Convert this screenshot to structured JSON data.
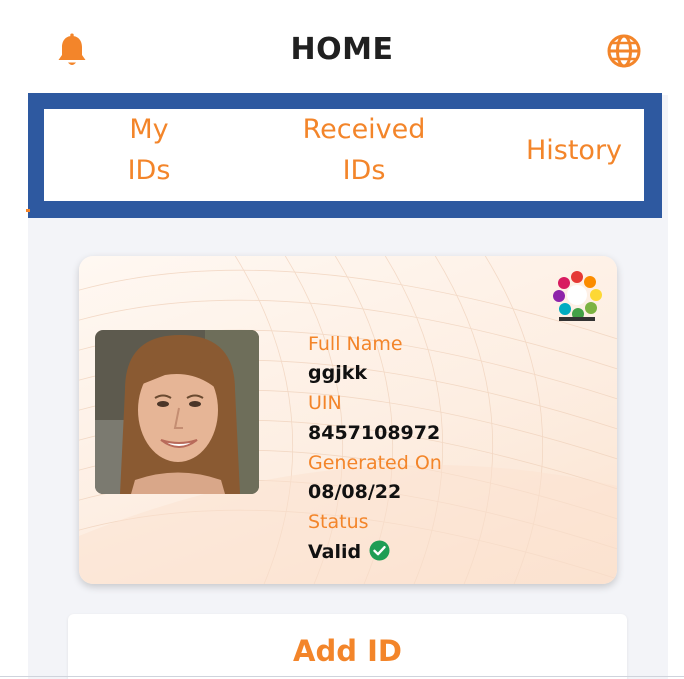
{
  "header": {
    "title": "HOME",
    "left_icon": "bell-icon",
    "right_icon": "globe-icon",
    "accent_color": "#f3852a"
  },
  "tabs": [
    {
      "label_line1": "My",
      "label_line2": "IDs"
    },
    {
      "label_line1": "Received",
      "label_line2": "IDs"
    },
    {
      "label_line1": "History",
      "label_line2": ""
    }
  ],
  "card": {
    "logo": "mosip-logo",
    "full_name_label": "Full Name",
    "full_name_value": "ggjkk",
    "uin_label": "UIN",
    "uin_value": "8457108972",
    "generated_on_label": "Generated On",
    "generated_on_value": "08/08/22",
    "status_label": "Status",
    "status_value": "Valid",
    "status_icon": "check-circle-icon",
    "status_color": "#1f9d55"
  },
  "actions": {
    "add_id_label": "Add ID"
  }
}
